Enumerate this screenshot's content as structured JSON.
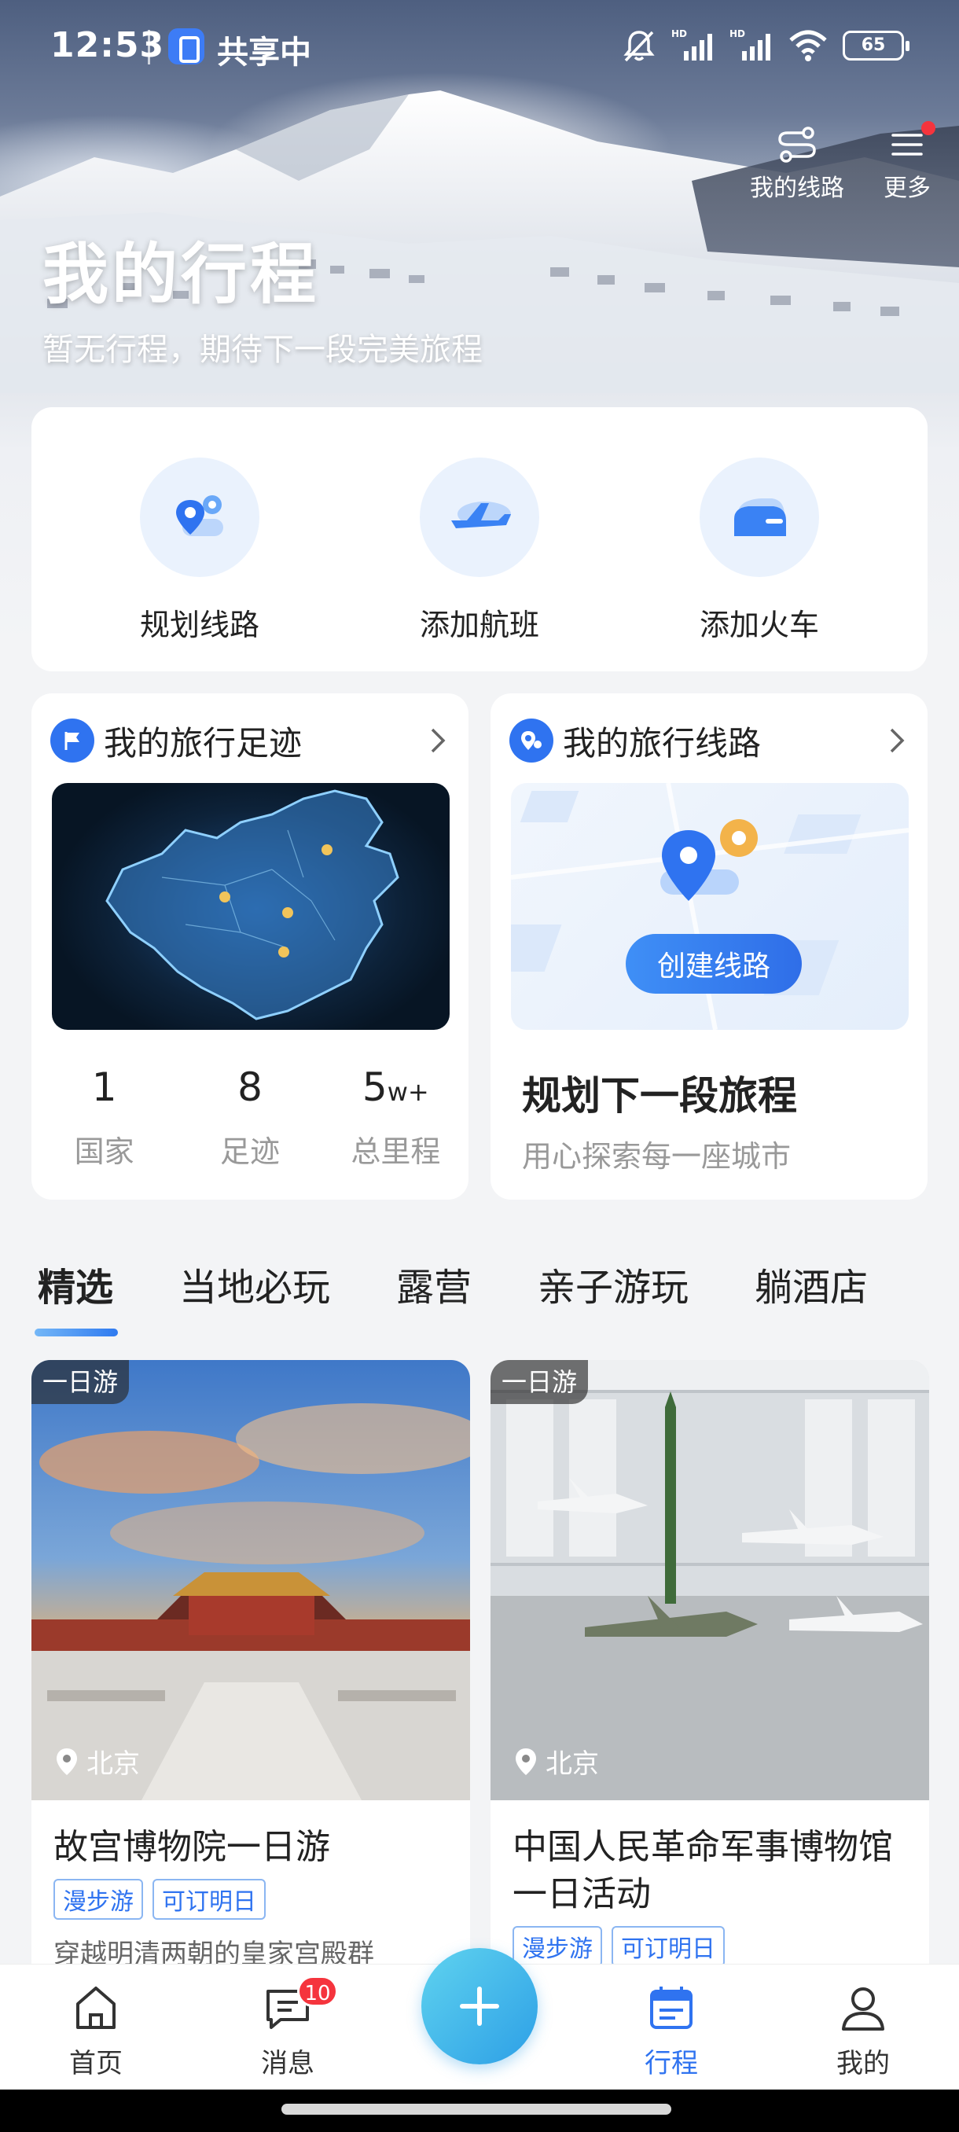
{
  "status_bar": {
    "time": "12:53",
    "sharing_label": "共享中",
    "signal_1": "HD",
    "signal_2": "HD",
    "battery": "65"
  },
  "header": {
    "my_routes_label": "我的线路",
    "more_label": "更多",
    "title": "我的行程",
    "subtitle": "暂无行程，期待下一段完美旅程"
  },
  "quick_actions": [
    {
      "label": "规划线路",
      "icon": "route-pin-icon"
    },
    {
      "label": "添加航班",
      "icon": "airplane-icon"
    },
    {
      "label": "添加火车",
      "icon": "train-icon"
    }
  ],
  "footprint": {
    "title": "我的旅行足迹",
    "stats": [
      {
        "value": "1",
        "unit": "",
        "label": "国家"
      },
      {
        "value": "8",
        "unit": "",
        "label": "足迹"
      },
      {
        "value": "5",
        "unit": "w+",
        "label": "总里程"
      }
    ]
  },
  "routes": {
    "title": "我的旅行线路",
    "create_button": "创建线路",
    "plan_title": "规划下一段旅程",
    "plan_sub": "用心探索每一座城市"
  },
  "tabs": [
    "精选",
    "当地必玩",
    "露营",
    "亲子游玩",
    "躺酒店"
  ],
  "products": [
    {
      "badge": "一日游",
      "location": "北京",
      "title": "故宫博物院一日游",
      "tags": [
        "漫步游",
        "可订明日"
      ],
      "desc": "穿越明清两朝的皇家宫殿群"
    },
    {
      "badge": "一日游",
      "location": "北京",
      "title": "中国人民革命军事博物馆一日活动",
      "tags": [
        "漫步游",
        "可订明日"
      ],
      "desc": ""
    }
  ],
  "bottom_nav": {
    "home": "首页",
    "messages": "消息",
    "messages_badge": "10",
    "trips": "行程",
    "mine": "我的"
  },
  "colors": {
    "accent": "#2f73f0",
    "badge_red": "#f5343d",
    "plus_button": "#3fb5eb"
  }
}
